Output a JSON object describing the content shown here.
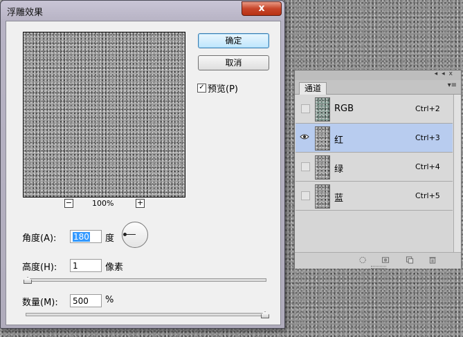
{
  "dialog": {
    "title": "浮雕效果",
    "close_label": "x",
    "ok_label": "确定",
    "cancel_label": "取消",
    "preview_check_label": "预览(P)",
    "preview_checked": true,
    "zoom": {
      "minus": "−",
      "plus": "+",
      "level": "100%"
    },
    "angle": {
      "label": "角度(A):",
      "value": "180",
      "unit": "度"
    },
    "height": {
      "label": "高度(H):",
      "value": "1",
      "unit": "像素"
    },
    "amount": {
      "label": "数量(M):",
      "value": "500",
      "unit": "%"
    }
  },
  "channels_panel": {
    "tab_label": "通道",
    "collapse_label": "◂◂",
    "close_label": "x",
    "menu_label": "▾≡",
    "channels": [
      {
        "name": "RGB",
        "shortcut": "Ctrl+2",
        "visible": false,
        "selected": false
      },
      {
        "name": "红",
        "shortcut": "Ctrl+3",
        "visible": true,
        "selected": true
      },
      {
        "name": "绿",
        "shortcut": "Ctrl+4",
        "visible": false,
        "selected": false
      },
      {
        "name": "蓝",
        "shortcut": "Ctrl+5",
        "visible": false,
        "selected": false
      }
    ],
    "footer_icons": [
      "load-selection-icon",
      "save-selection-icon",
      "new-channel-icon",
      "trash-icon"
    ]
  }
}
